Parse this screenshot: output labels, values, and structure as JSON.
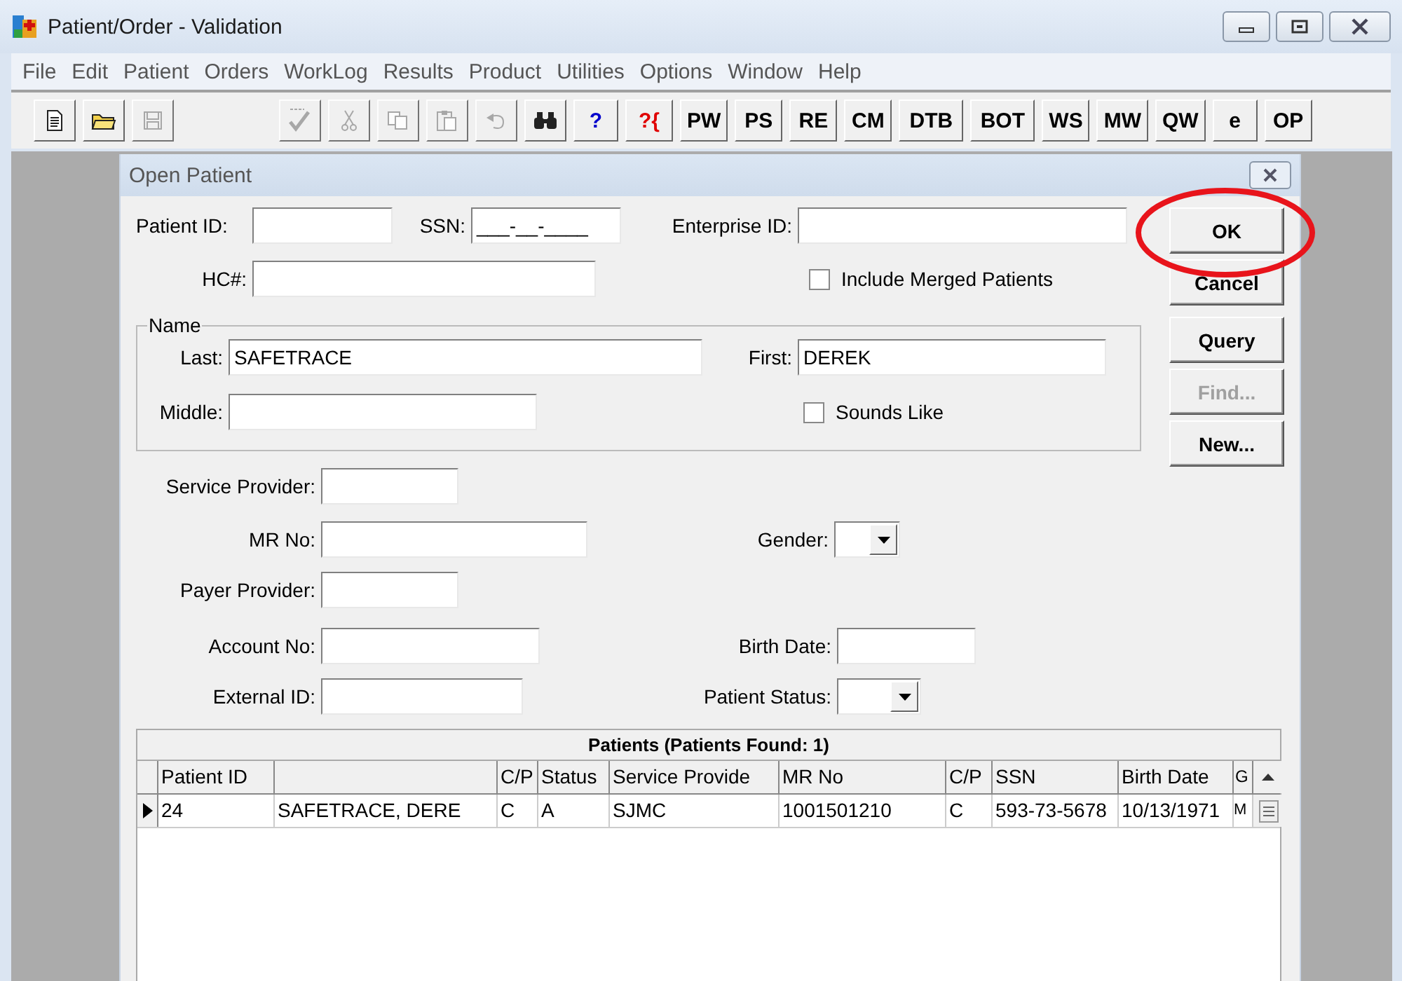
{
  "window": {
    "title": "Patient/Order - Validation"
  },
  "menu": [
    "File",
    "Edit",
    "Patient",
    "Orders",
    "WorkLog",
    "Results",
    "Product",
    "Utilities",
    "Options",
    "Window",
    "Help"
  ],
  "toolbar": {
    "groups": [
      [
        {
          "kind": "icon",
          "disabled": false
        },
        {
          "kind": "icon",
          "disabled": false
        },
        {
          "kind": "icon",
          "disabled": true
        }
      ],
      [
        {
          "kind": "icon",
          "disabled": true
        },
        {
          "kind": "icon",
          "disabled": true
        },
        {
          "kind": "icon",
          "disabled": true
        },
        {
          "kind": "icon",
          "disabled": true
        },
        {
          "kind": "icon",
          "disabled": true
        },
        {
          "kind": "icon",
          "disabled": false
        },
        {
          "kind": "text",
          "label": "?",
          "color": "#0000cc"
        },
        {
          "kind": "text",
          "label": "?{",
          "color": "#e00000"
        },
        {
          "kind": "text",
          "label": "PW"
        },
        {
          "kind": "text",
          "label": "PS"
        },
        {
          "kind": "text",
          "label": "RE"
        },
        {
          "kind": "text",
          "label": "CM"
        },
        {
          "kind": "text",
          "label": "DTB"
        },
        {
          "kind": "text",
          "label": "BOT"
        },
        {
          "kind": "text",
          "label": "WS"
        },
        {
          "kind": "text",
          "label": "MW"
        },
        {
          "kind": "text",
          "label": "QW"
        },
        {
          "kind": "text",
          "label": "e"
        },
        {
          "kind": "text",
          "label": "OP"
        }
      ]
    ]
  },
  "dialog": {
    "title": "Open Patient",
    "header_rows": [
      [
        {
          "kind": "field",
          "label": "Patient ID:"
        },
        {
          "kind": "field",
          "label": "SSN:",
          "value": "___-__-____"
        },
        {
          "kind": "field",
          "label": "Enterprise ID:"
        }
      ],
      [
        {
          "kind": "field",
          "label": "HC#:"
        },
        {
          "kind": "checkbox",
          "label": "Include Merged Patients",
          "checked": false
        }
      ]
    ],
    "name_group": {
      "legend": "Name",
      "rows": [
        [
          {
            "kind": "field",
            "label": "Last:",
            "value": "SAFETRACE"
          },
          {
            "kind": "field",
            "label": "First:",
            "value": "DEREK"
          }
        ],
        [
          {
            "kind": "field",
            "label": "Middle:"
          },
          {
            "kind": "checkbox",
            "label": "Sounds Like",
            "checked": false
          }
        ]
      ]
    },
    "detail_rows": [
      [
        {
          "kind": "field",
          "label": "Service Provider:"
        }
      ],
      [
        {
          "kind": "field",
          "label": "MR No:"
        },
        {
          "kind": "combo",
          "label": "Gender:"
        }
      ],
      [
        {
          "kind": "field",
          "label": "Payer Provider:"
        }
      ],
      [
        {
          "kind": "field",
          "label": "Account No:"
        },
        {
          "kind": "field",
          "label": "Birth Date:"
        }
      ],
      [
        {
          "kind": "field",
          "label": "External ID:"
        },
        {
          "kind": "combo",
          "label": "Patient Status:"
        }
      ]
    ],
    "buttons": [
      {
        "label": "OK",
        "disabled": false
      },
      {
        "label": "Cancel",
        "disabled": false
      },
      {
        "label": "Query",
        "disabled": false
      },
      {
        "label": "Find...",
        "disabled": true
      },
      {
        "label": "New...",
        "disabled": false
      }
    ],
    "grid": {
      "caption": "Patients  (Patients Found: 1)",
      "columns": [
        {
          "label": "Patient ID"
        },
        {},
        {
          "label": "C/P"
        },
        {
          "label": "Status"
        },
        {
          "label": "Service Provide"
        },
        {
          "label": "MR No"
        },
        {
          "label": "C/P"
        },
        {
          "label": "SSN"
        },
        {
          "label": "Birth Date"
        },
        {
          "label": "G"
        }
      ],
      "rows": [
        {
          "selected": true,
          "cells": [
            "24",
            "SAFETRACE, DERE",
            "C",
            "A",
            "SJMC",
            "1001501210",
            "C",
            "593-73-5678",
            "10/13/1971",
            "M"
          ]
        }
      ]
    }
  },
  "annotation": {
    "kind": "ellipse"
  }
}
